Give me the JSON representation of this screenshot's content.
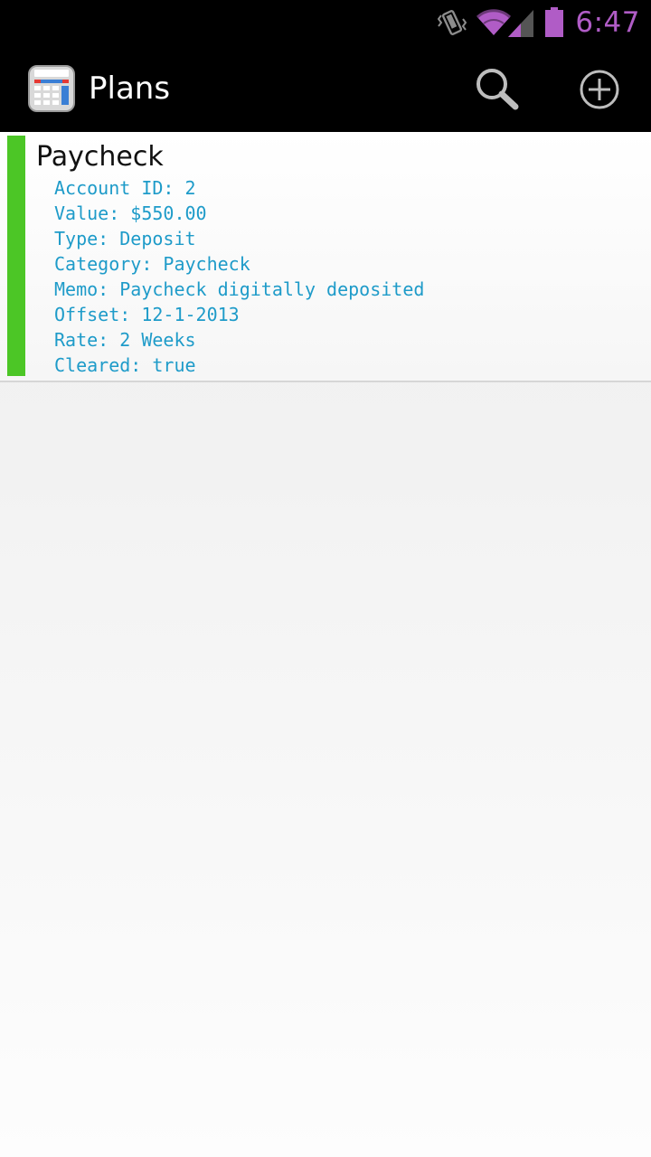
{
  "status_bar": {
    "time": "6:47",
    "icons": [
      "vibrate-icon",
      "wifi-icon",
      "cell-signal-icon",
      "battery-icon"
    ],
    "accent_color": "#b05cc6"
  },
  "action_bar": {
    "title": "Plans",
    "app_icon": "calculator-icon",
    "actions": [
      "search-icon",
      "add-circle-icon"
    ]
  },
  "plan": {
    "name": "Paycheck",
    "strip_color": "#4cc626",
    "detail_color": "#1e9bc9",
    "details": [
      "Account ID: 2",
      "Value: $550.00",
      "Type: Deposit",
      "Category: Paycheck",
      "Memo: Paycheck digitally deposited",
      "Offset: 12-1-2013",
      "Rate: 2 Weeks",
      "Cleared: true"
    ]
  }
}
